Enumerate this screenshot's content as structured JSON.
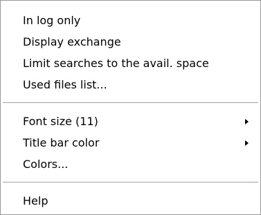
{
  "menu": {
    "items": [
      {
        "label": "In log only"
      },
      {
        "label": "Display exchange"
      },
      {
        "label": "Limit searches to the avail. space"
      },
      {
        "label": "Used files list..."
      },
      {
        "label": "Font size (11)",
        "submenu": true
      },
      {
        "label": "Title bar color",
        "submenu": true
      },
      {
        "label": "Colors..."
      },
      {
        "label": "Help"
      }
    ]
  }
}
